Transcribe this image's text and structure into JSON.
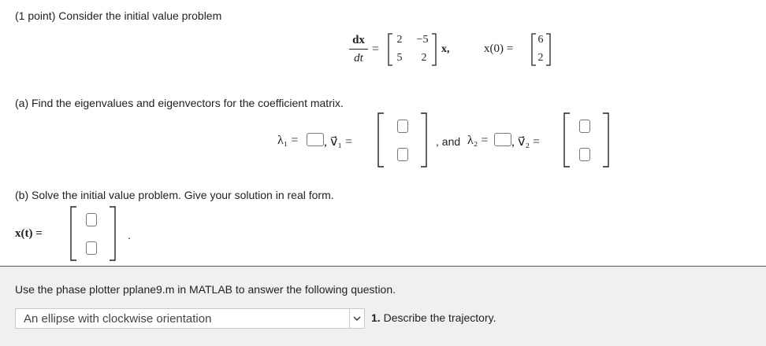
{
  "problem": {
    "header": "(1 point) Consider the initial value problem",
    "ode": {
      "lhs_num": "dx",
      "lhs_den": "dt",
      "equals": "=",
      "matrix": [
        [
          "2",
          "−5"
        ],
        [
          "5",
          "2"
        ]
      ],
      "vector_var": "x,",
      "initial_label": "x(0) =",
      "initial_vector": [
        "6",
        "2"
      ]
    }
  },
  "part_a": {
    "prompt": "(a) Find the eigenvalues and eigenvectors for the coefficient matrix.",
    "lambda1_label": "λ₁ =",
    "v1_label": ", v⃗₁ =",
    "and_label": ", and",
    "lambda2_label": "λ₂ =",
    "v2_label": ", v⃗₂ ="
  },
  "part_b": {
    "prompt": "(b) Solve the initial value problem. Give your solution in real form.",
    "xt_label": "x(t) =",
    "period": "."
  },
  "part_c": {
    "instruction": "Use the phase plotter pplane9.m in MATLAB to answer the following question.",
    "select_value": "An ellipse with clockwise orientation",
    "question": "1. Describe the trajectory."
  }
}
